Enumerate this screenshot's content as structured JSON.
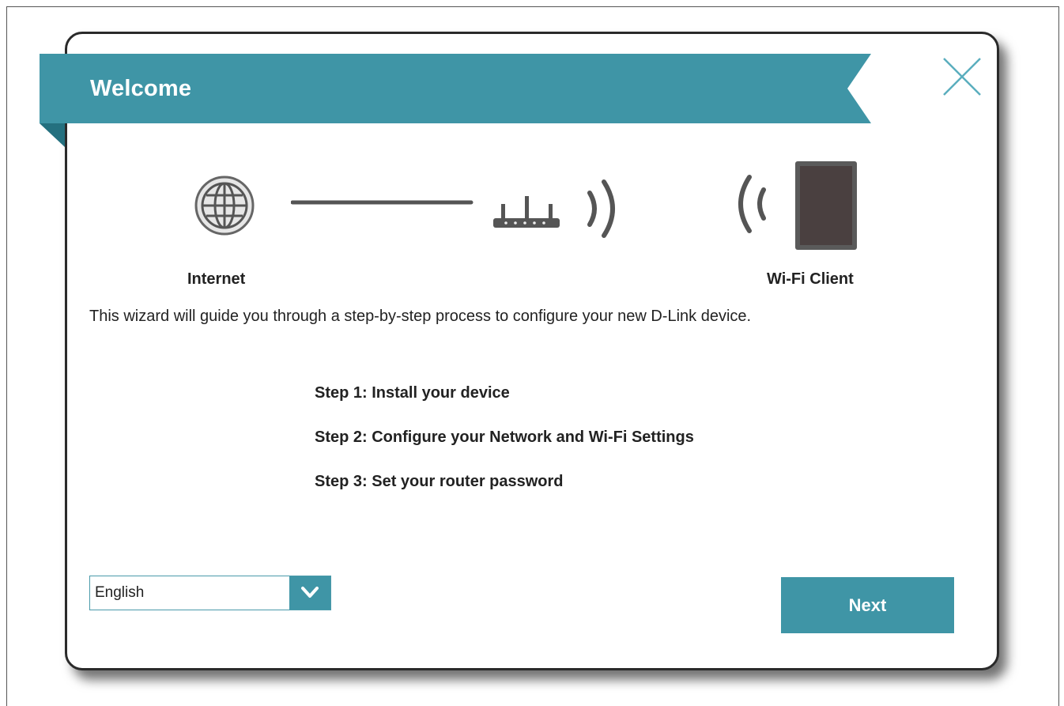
{
  "banner": {
    "title": "Welcome",
    "color": "#3f95a6",
    "shade_color": "#24707f"
  },
  "diagram": {
    "internet_label": "Internet",
    "client_label": "Wi-Fi Client",
    "icons": [
      "globe-icon",
      "router-icon",
      "wifi-signal-icon",
      "tablet-icon"
    ]
  },
  "intro": {
    "text": "This wizard will guide you through a step-by-step process to configure your new D-Link device."
  },
  "steps": [
    {
      "label": "Step 1:  Install your device"
    },
    {
      "label": "Step 2:  Configure your Network and Wi-Fi Settings"
    },
    {
      "label": "Step 3:  Set your router password"
    }
  ],
  "language": {
    "selected": "English"
  },
  "actions": {
    "next_label": "Next"
  }
}
